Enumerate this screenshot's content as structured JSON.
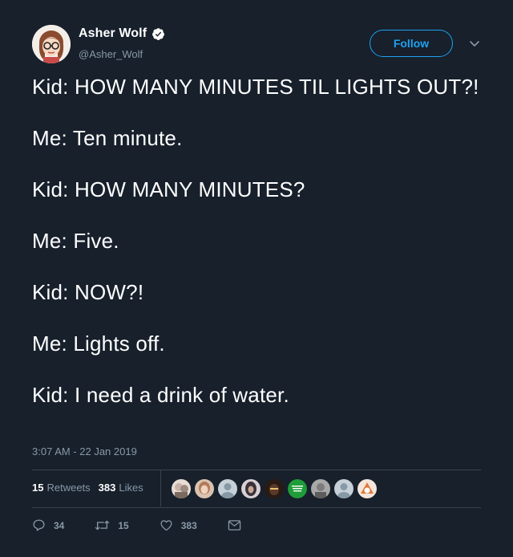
{
  "author": {
    "display_name": "Asher Wolf",
    "handle": "@Asher_Wolf",
    "verified": true,
    "avatar_icon": "cartoon-woman-with-glasses-avatar"
  },
  "header": {
    "follow_label": "Follow",
    "menu_icon": "chevron-down-icon"
  },
  "tweet": {
    "lines": [
      "Kid: HOW MANY MINUTES TIL LIGHTS OUT?!",
      "Me: Ten minute.",
      "Kid: HOW MANY MINUTES?",
      "Me: Five.",
      "Kid: NOW?!",
      "Me: Lights off.",
      "Kid: I need a drink of water."
    ],
    "timestamp": "3:07 AM - 22 Jan 2019"
  },
  "stats": {
    "retweets_count": "15",
    "retweets_label": "Retweets",
    "likes_count": "383",
    "likes_label": "Likes"
  },
  "likers": [
    {
      "icon": "liker-avatar-1",
      "color": "#c9b3a8"
    },
    {
      "icon": "liker-avatar-2",
      "color": "#b07b5a"
    },
    {
      "icon": "default-avatar-icon",
      "color": "#8899a6"
    },
    {
      "icon": "liker-avatar-4",
      "color": "#3a3238"
    },
    {
      "icon": "liker-avatar-5",
      "color": "#5a3a2a"
    },
    {
      "icon": "green-badge-avatar",
      "color": "#1f9d3a"
    },
    {
      "icon": "liker-avatar-7",
      "color": "#7c7c7c"
    },
    {
      "icon": "default-avatar-icon",
      "color": "#8899a6"
    },
    {
      "icon": "liker-avatar-9",
      "color": "#e07a3a"
    }
  ],
  "actions": {
    "reply_count": "34",
    "retweet_count": "15",
    "like_count": "383"
  },
  "colors": {
    "background": "#17202b",
    "accent": "#1da1f2",
    "muted": "#8899a6",
    "divider": "#38444d"
  }
}
